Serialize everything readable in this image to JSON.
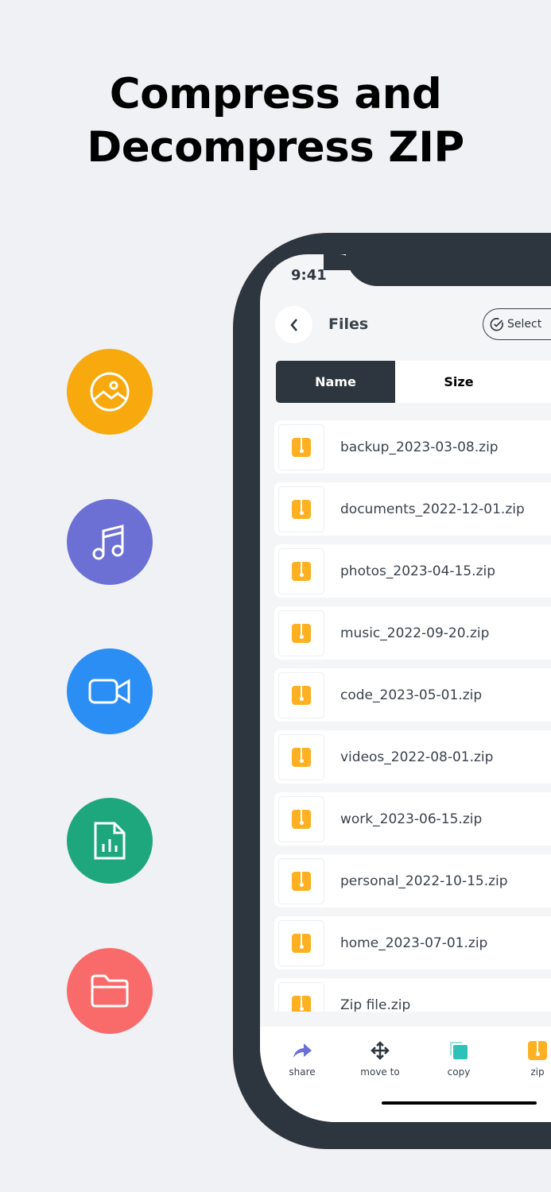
{
  "headline": {
    "line1": "Compress and",
    "line2": "Decompress ZIP"
  },
  "features": [
    {
      "icon": "image-icon",
      "color": "#f7a90d"
    },
    {
      "icon": "music-icon",
      "color": "#6c6fd4"
    },
    {
      "icon": "video-icon",
      "color": "#2b8ef5"
    },
    {
      "icon": "document-chart-icon",
      "color": "#1ea77d"
    },
    {
      "icon": "folder-icon",
      "color": "#f96b6b"
    }
  ],
  "status": {
    "time": "9:41"
  },
  "header": {
    "title": "Files",
    "select_label": "Select"
  },
  "sort": {
    "tabs": [
      "Name",
      "Size"
    ],
    "active": "Name"
  },
  "files": [
    "backup_2023-03-08.zip",
    "documents_2022-12-01.zip",
    "photos_2023-04-15.zip",
    "music_2022-09-20.zip",
    "code_2023-05-01.zip",
    "videos_2022-08-01.zip",
    "work_2023-06-15.zip",
    "personal_2022-10-15.zip",
    "home_2023-07-01.zip",
    "Zip file.zip"
  ],
  "actions": [
    {
      "label": "share"
    },
    {
      "label": "move to"
    },
    {
      "label": "copy"
    },
    {
      "label": "zip"
    }
  ]
}
